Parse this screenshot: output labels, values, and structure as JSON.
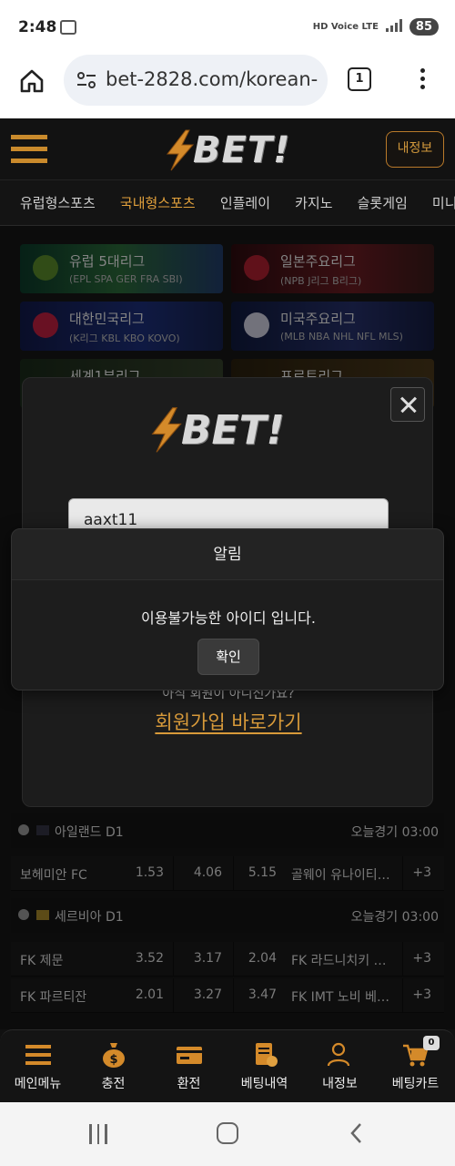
{
  "status_bar": {
    "time": "2:48",
    "network": "HD Voice LTE",
    "battery": "85"
  },
  "browser": {
    "url": "bet-2828.com/korean-",
    "tab_count": "1"
  },
  "site": {
    "logo_text": "BET!",
    "my_info_button": "내정보",
    "accent": "#d89a3a"
  },
  "categories": [
    "유럽형스포츠",
    "국내형스포츠",
    "인플레이",
    "카지노",
    "슬롯게임",
    "미니"
  ],
  "active_category": "국내형스포츠",
  "leagues": [
    {
      "title": "유럽 5대리그",
      "sub": "(EPL SPA GER FRA SBI)"
    },
    {
      "title": "일본주요리그",
      "sub": "(NPB J리그 B리그)"
    },
    {
      "title": "대한민국리그",
      "sub": "(K리그 KBL KBO KOVO)"
    },
    {
      "title": "미국주요리그",
      "sub": "(MLB NBA NHL NFL MLS)"
    },
    {
      "title": "세계1부리그",
      "sub": ""
    },
    {
      "title": "프로토리그",
      "sub": ""
    }
  ],
  "match_groups": [
    {
      "league": "아일랜드 D1",
      "time": "오늘경기 03:00",
      "rows": [
        {
          "home": "보헤미안 FC",
          "odd1": "1.53",
          "odd2": "4.06",
          "odd3": "5.15",
          "away": "골웨이 유나이티…",
          "more": "+3"
        }
      ]
    },
    {
      "league": "세르비아 D1",
      "time": "오늘경기 03:00",
      "rows": [
        {
          "home": "FK 제문",
          "odd1": "3.52",
          "odd2": "3.17",
          "odd3": "2.04",
          "away": "FK 라드니치키 …",
          "more": "+3"
        },
        {
          "home": "FK 파르티잔",
          "odd1": "2.01",
          "odd2": "3.27",
          "odd3": "3.47",
          "away": "FK IMT 노비 베…",
          "more": "+3"
        }
      ]
    }
  ],
  "login_modal": {
    "logo_text": "BET!",
    "id_value": "aaxt11",
    "signup_question": "아직 회원이 아니신가요?",
    "signup_link": "회원가입 바로가기"
  },
  "alert": {
    "title": "알림",
    "message": "이용불가능한 아이디 입니다.",
    "ok_label": "확인"
  },
  "bottom_nav": [
    {
      "label": "메인메뉴",
      "icon": "menu-icon"
    },
    {
      "label": "충전",
      "icon": "money-bag-icon"
    },
    {
      "label": "환전",
      "icon": "card-icon"
    },
    {
      "label": "베팅내역",
      "icon": "betting-history-icon"
    },
    {
      "label": "내정보",
      "icon": "user-icon"
    },
    {
      "label": "베팅카트",
      "icon": "cart-icon"
    }
  ],
  "cart_count": "0"
}
